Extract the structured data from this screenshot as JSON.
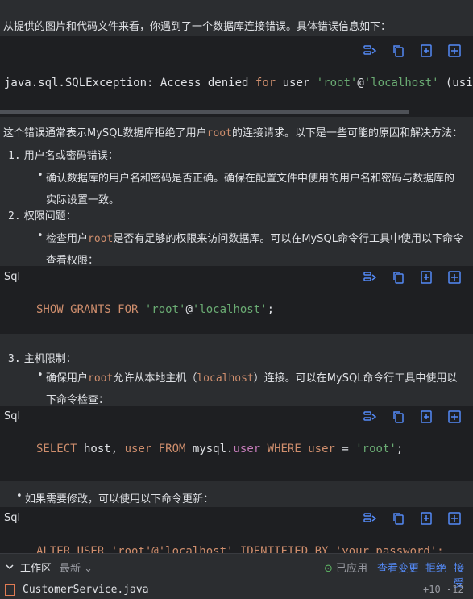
{
  "intro": "从提供的图片和代码文件来看，你遇到了一个数据库连接错误。具体错误信息如下：",
  "error_code": {
    "exception": "java.sql.SQLException",
    "colon": ": ",
    "text1": "Access denied ",
    "kw_for": "for",
    "text2": " user ",
    "str_root": "'root'",
    "at": "@",
    "str_host": "'localhost'",
    "text3": " (using p"
  },
  "explain": {
    "p1": "这个错误通常表示MySQL数据库拒绝了用户",
    "root": "root",
    "p2": "的连接请求。以下是一些可能的原因和解决方法："
  },
  "items": [
    {
      "num": "1.",
      "title": "用户名或密码错误："
    },
    {
      "num": "2.",
      "title": "权限问题："
    },
    {
      "num": "3.",
      "title": "主机限制："
    }
  ],
  "bullet": "•",
  "b1": {
    "l1": "确认数据库的用户名和密码是否正确。确保在配置文件中使用的用户名和密码与数据库的",
    "l2": "实际设置一致。"
  },
  "b2": {
    "p1": "检查用户",
    "root": "root",
    "p2": "是否有足够的权限来访问数据库。可以在MySQL命令行工具中使用以下命令",
    "l2": "查看权限："
  },
  "b3": {
    "p1": "确保用户",
    "root": "root",
    "p2": "允许从本地主机（",
    "host": "localhost",
    "p3": "）连接。可以在MySQL命令行工具中使用以",
    "l2": "下命令检查："
  },
  "b4": "如果需要修改，可以使用以下命令更新：",
  "code1": {
    "lang": "Sql",
    "kw": "SHOW GRANTS FOR ",
    "str_root": "'root'",
    "at": "@",
    "str_host": "'localhost'",
    "end": ";"
  },
  "code2": {
    "lang": "Sql",
    "kw1": "SELECT",
    "t1": " host, ",
    "kw2": "user",
    "t2": " ",
    "kw3": "FROM",
    "t3": " mysql.",
    "fld": "user",
    "t4": " ",
    "kw4": "WHERE",
    "t5": " ",
    "kw5": "user",
    "t6": " = ",
    "str": "'root'",
    "t7": ";"
  },
  "code3": {
    "lang": "Sql",
    "partial": "ALTER USER 'root'@'localhost' IDENTIFIED BY 'your_password';"
  },
  "bottom": {
    "workspace": "工作区",
    "latest": "最新",
    "applied": "已应用",
    "view_changes": "查看变更",
    "reject": "拒绝",
    "accept": "接受",
    "file": "CustomerService.java",
    "diff": "+10 -12"
  },
  "colors": {
    "accent": "#548af7",
    "keyword": "#cf8e6d",
    "string": "#6aab73",
    "bg": "#2b2d30",
    "code_bg": "#1e1f22"
  }
}
